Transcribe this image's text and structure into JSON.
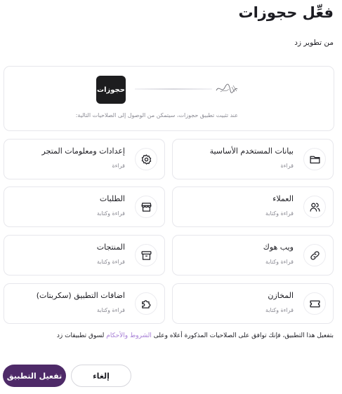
{
  "header": {
    "title": "فعِّل حجوزات",
    "developer": "من تطوير زد"
  },
  "connect": {
    "app_logo_text": "حجوزات",
    "note": "عند تثبيت تطبيق حجوزات، سيتمكن من الوصول إلى الصلاحيات التالية:"
  },
  "permissions": [
    {
      "title": "بيانات المستخدم الأساسية",
      "access": "قراءة",
      "icon": "folder-icon"
    },
    {
      "title": "إعدادات ومعلومات المتجر",
      "access": "قراءة",
      "icon": "gear-icon"
    },
    {
      "title": "العملاء",
      "access": "قراءة وكتابة",
      "icon": "users-icon"
    },
    {
      "title": "الطلبات",
      "access": "قراءة وكتابة",
      "icon": "store-icon"
    },
    {
      "title": "ويب هوك",
      "access": "قراءة وكتابة",
      "icon": "webhook-icon"
    },
    {
      "title": "المنتجات",
      "access": "قراءة وكتابة",
      "icon": "archive-icon"
    },
    {
      "title": "المخازن",
      "access": "قراءة وكتابة",
      "icon": "ticket-icon"
    },
    {
      "title": "اضافات التطبيق (سكربتات)",
      "access": "قراءة وكتابة",
      "icon": "puzzle-icon"
    }
  ],
  "terms": {
    "before": "بتفعيل هذا التطبيق، فإنك توافق على الصلاحيات المذكورة أعلاه وعلى ",
    "link": "الشروط والأحكام",
    "after": " لسوق تطبيقات زد"
  },
  "buttons": {
    "activate": "تفعيل التطبيق",
    "cancel": "إلغاء"
  },
  "colors": {
    "primary": "#4e2a68",
    "link": "#a77fd6",
    "border": "#e7e7ec",
    "muted": "#8a8a93"
  }
}
